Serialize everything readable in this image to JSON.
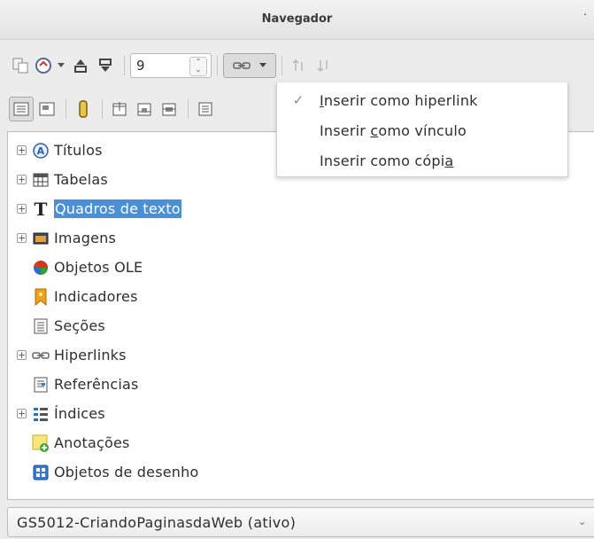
{
  "window": {
    "title": "Navegador",
    "menu_dot": "·"
  },
  "toolbar": {
    "spin_value": "9",
    "spin_up": "⌃",
    "spin_down": "⌄"
  },
  "drag_menu": {
    "items": [
      {
        "label": "Inserir como hiperlink",
        "pre": "",
        "mnemonic": "I",
        "post": "nserir como hiperlink",
        "checked": true
      },
      {
        "label": "Inserir como vínculo",
        "pre": "Inserir ",
        "mnemonic": "c",
        "post": "omo vínculo",
        "checked": false
      },
      {
        "label": "Inserir como cópia",
        "pre": "Inserir como cópi",
        "mnemonic": "a",
        "post": "",
        "checked": false
      }
    ],
    "check_glyph": "✓"
  },
  "tree": {
    "items": [
      {
        "label": "Títulos",
        "expandable": true,
        "icon": "titles-icon"
      },
      {
        "label": "Tabelas",
        "expandable": true,
        "icon": "table-icon"
      },
      {
        "label": "Quadros de texto",
        "expandable": true,
        "icon": "text-frame-icon",
        "selected": true
      },
      {
        "label": "Imagens",
        "expandable": true,
        "icon": "image-icon"
      },
      {
        "label": "Objetos OLE",
        "expandable": false,
        "icon": "ole-object-icon"
      },
      {
        "label": "Indicadores",
        "expandable": false,
        "icon": "bookmark-icon"
      },
      {
        "label": "Seções",
        "expandable": false,
        "icon": "section-icon"
      },
      {
        "label": "Hiperlinks",
        "expandable": true,
        "icon": "hyperlink-icon"
      },
      {
        "label": "Referências",
        "expandable": false,
        "icon": "reference-icon"
      },
      {
        "label": "Índices",
        "expandable": true,
        "icon": "index-icon"
      },
      {
        "label": "Anotações",
        "expandable": false,
        "icon": "comment-icon"
      },
      {
        "label": "Objetos de desenho",
        "expandable": false,
        "icon": "drawing-object-icon"
      }
    ],
    "expander_glyph": "+"
  },
  "document_selector": {
    "value": "GS5012-CriandoPaginasdaWeb (ativo)",
    "arrow": "⌄"
  },
  "colors": {
    "selection": "#4a90d9",
    "background": "#ececec",
    "tree_bg": "#ffffff"
  }
}
